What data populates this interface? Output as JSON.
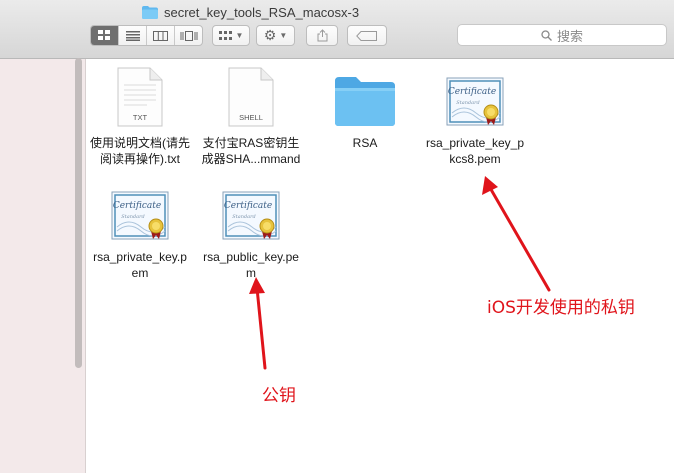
{
  "window": {
    "title": "secret_key_tools_RSA_macosx-3"
  },
  "toolbar": {
    "views": [
      "icon-view",
      "list-view",
      "column-view",
      "coverflow-view"
    ],
    "arrange_icon": "grid-icon",
    "action_icon": "gear-icon",
    "share_icon": "share-icon",
    "tag_icon": "tag-icon"
  },
  "search": {
    "placeholder": "搜索"
  },
  "files": [
    {
      "name": "使用说明文档(请先阅读再操作).txt",
      "display": "使用说明文档(请先\n阅读再操作).txt",
      "type": "txt",
      "icon_label": "TXT"
    },
    {
      "name": "支付宝RAS密钥生成器SHA...mmand",
      "display": "支付宝RAS密钥生\n成器SHA...mmand",
      "type": "shell",
      "icon_label": "SHELL"
    },
    {
      "name": "RSA",
      "display": "RSA",
      "type": "folder"
    },
    {
      "name": "rsa_private_key_pkcs8.pem",
      "display": "rsa_private_key_p\nkcs8.pem",
      "type": "certificate"
    },
    {
      "name": "rsa_private_key.pem",
      "display": "rsa_private_key.p\nem",
      "type": "certificate"
    },
    {
      "name": "rsa_public_key.pem",
      "display": "rsa_public_key.pe\nm",
      "type": "certificate"
    }
  ],
  "annotations": {
    "ios_private_key": "iOS开发使用的私钥",
    "public_key": "公钥",
    "color": "#e0141b"
  },
  "colors": {
    "folder": "#5fb8ef",
    "sidebar": "#f3e9ea"
  }
}
